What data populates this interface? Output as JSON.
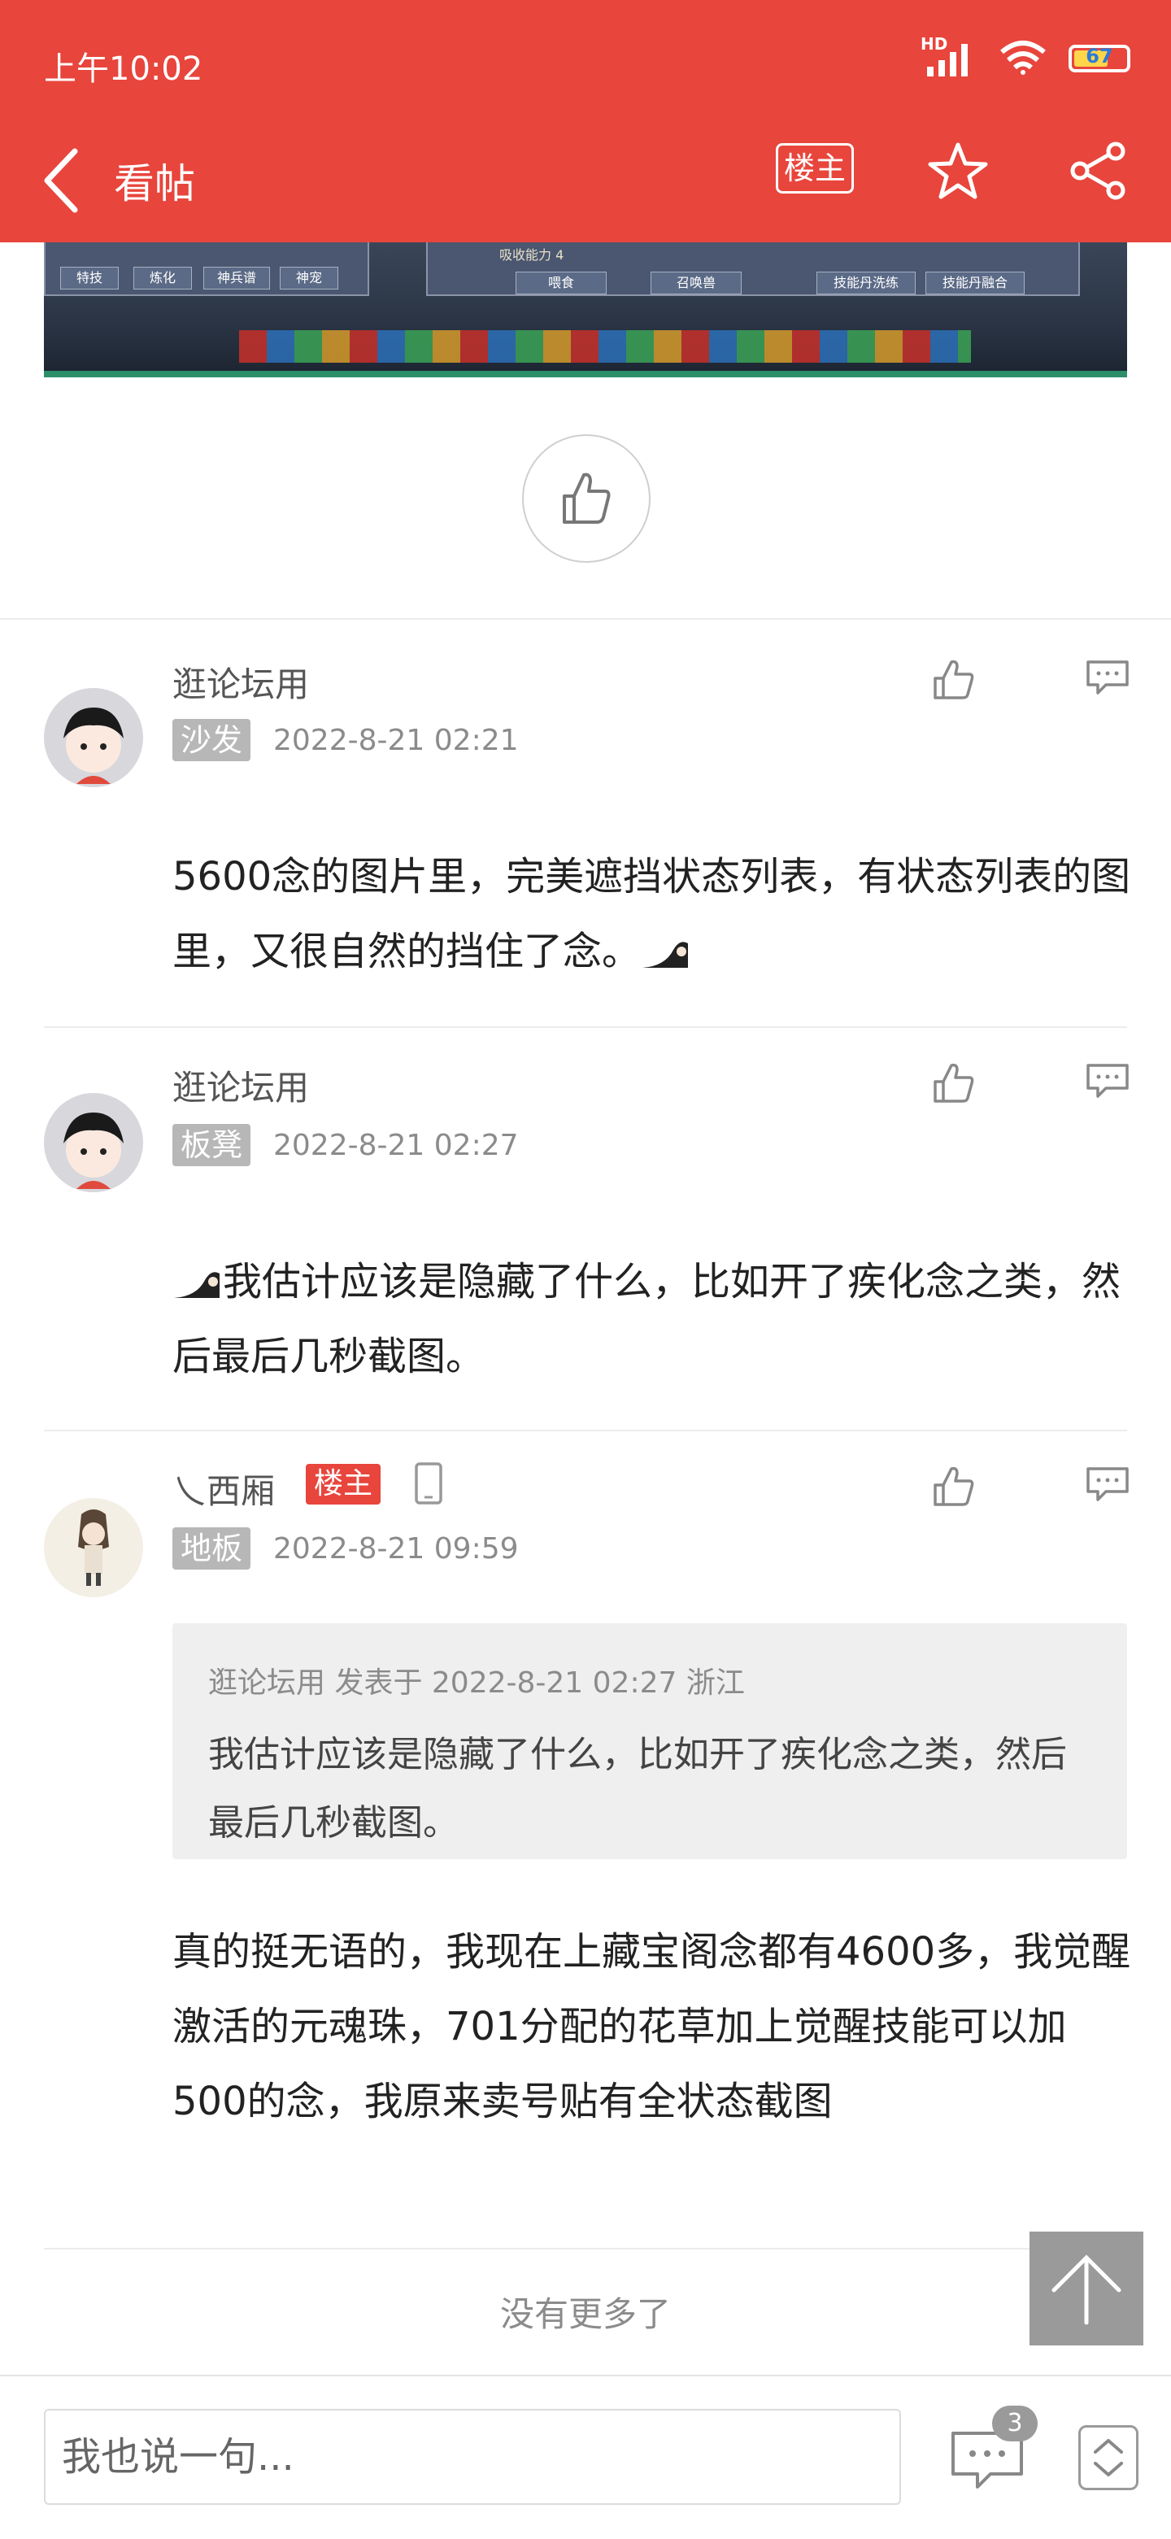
{
  "status_bar": {
    "time": "上午10:02",
    "battery": "67",
    "network": "HD"
  },
  "nav": {
    "title": "看帖",
    "owner_filter": "楼主"
  },
  "colors": {
    "brand_red": "#e8453c",
    "badge_gray": "#b7b7b7"
  },
  "posts": [
    {
      "username": "逛论坛用",
      "floor": "沙发",
      "time": "2022-8-21 02:21",
      "text": "5600念的图片里，完美遮挡状态列表，有状态列表的图里，又很自然的挡住了念。"
    },
    {
      "username": "逛论坛用",
      "floor": "板凳",
      "time": "2022-8-21 02:27",
      "text": "我估计应该是隐藏了什么，比如开了疾化念之类，然后最后几秒截图。"
    },
    {
      "username": "乀西厢",
      "owner_badge": "楼主",
      "floor": "地板",
      "time": "2022-8-21 09:59",
      "quote": {
        "meta": "逛论坛用 发表于 2022-8-21 02:27 浙江",
        "text": "我估计应该是隐藏了什么，比如开了疾化念之类，然后最后几秒截图。"
      },
      "text": "真的挺无语的，我现在上藏宝阁念都有4600多，我觉醒激活的元魂珠，701分配的花草加上觉醒技能可以加500的念，我原来卖号贴有全状态截图"
    }
  ],
  "game_screenshot": {
    "labels": [
      "吸收能力 4",
      "喂食",
      "召唤兽",
      "技能丹洗练",
      "技能丹融合",
      "特技",
      "炼化",
      "神兵谱",
      "神宠"
    ]
  },
  "footer": {
    "no_more": "没有更多了"
  },
  "bottom_bar": {
    "input_placeholder": "我也说一句...",
    "comment_count": "3"
  }
}
